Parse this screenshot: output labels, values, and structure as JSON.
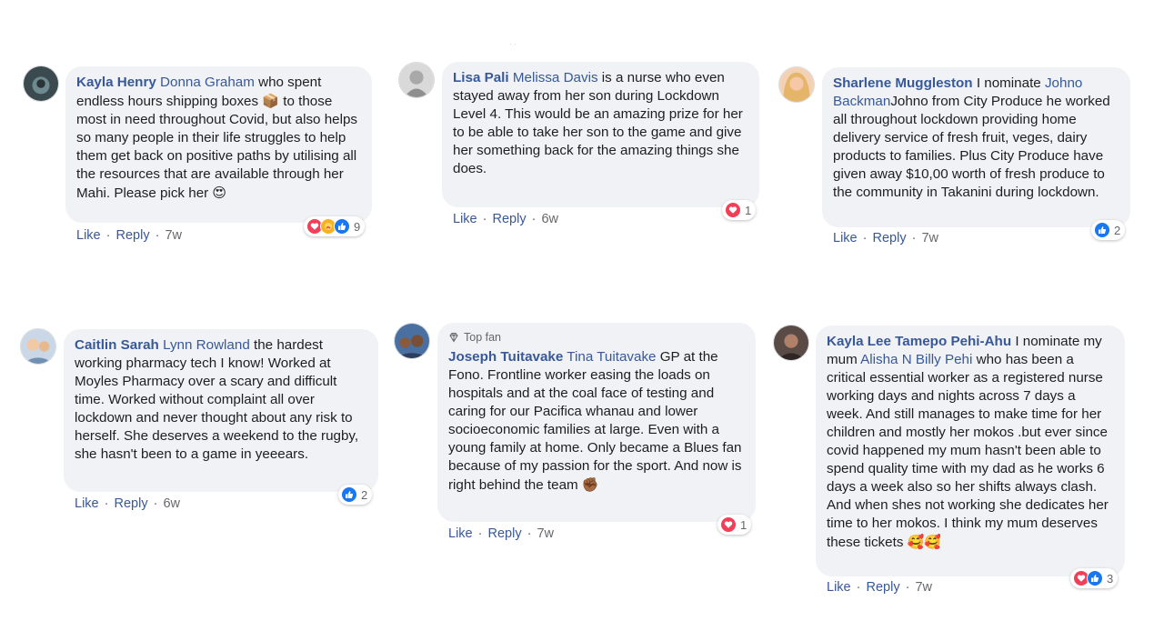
{
  "comments": [
    {
      "author": "Kayla Henry",
      "mention": "Donna Graham",
      "text_before": " who spent endless hours shipping boxes ",
      "emoji1": "📦",
      "text_after": " to those most in need throughout Covid, but also helps so many people in their life struggles to help them get back on positive paths by utilising all the resources that are available through her Mahi. Please pick her ",
      "emoji2": "😍",
      "actions": {
        "like": "Like",
        "reply": "Reply",
        "time": "7w"
      },
      "reaction_count": "9",
      "reaction_icons": [
        "love-icon",
        "care-icon",
        "like-icon"
      ]
    },
    {
      "author": "Lisa Pali",
      "mention": "Melissa Davis",
      "text_after": " is a nurse who even stayed away from her son during Lockdown Level 4. This would be an amazing prize for her to be able to take her son to the game and give her something back for the amazing things she does.",
      "actions": {
        "like": "Like",
        "reply": "Reply",
        "time": "6w"
      },
      "reaction_count": "1",
      "reaction_icons": [
        "love-icon"
      ]
    },
    {
      "author": "Sharlene Muggleston",
      "text_before": " I nominate ",
      "mention": "Johno Backman",
      "text_after": "Johno from City Produce he worked all throughout lockdown providing home delivery service of fresh fruit, veges, dairy products to families. Plus City Produce have given away $10,00 worth of fresh produce to the community in Takanini during lockdown.",
      "actions": {
        "like": "Like",
        "reply": "Reply",
        "time": "7w"
      },
      "reaction_count": "2",
      "reaction_icons": [
        "like-icon"
      ]
    },
    {
      "author": "Caitlin Sarah",
      "mention": "Lynn Rowland",
      "text_after": " the hardest working pharmacy tech I know! Worked at Moyles Pharmacy over a scary and difficult time. Worked without complaint all over lockdown and never thought about any risk to herself. She deserves a weekend to the rugby, she hasn't been to a game in yeeears.",
      "actions": {
        "like": "Like",
        "reply": "Reply",
        "time": "6w"
      },
      "reaction_count": "2",
      "reaction_icons": [
        "like-icon"
      ]
    },
    {
      "badge": "Top fan",
      "author": "Joseph Tuitavake",
      "mention": "Tina Tuitavake",
      "text_after": " GP at the Fono. Frontline worker easing the loads on hospitals and at the coal face of testing and caring for our Pacifica whanau and lower socioeconomic families at large. Even with a young family at home. Only became a Blues fan because of my passion for the sport. And now is right behind the team ",
      "emoji2": "✊🏾",
      "actions": {
        "like": "Like",
        "reply": "Reply",
        "time": "7w"
      },
      "reaction_count": "1",
      "reaction_icons": [
        "love-icon"
      ]
    },
    {
      "author": "Kayla Lee Tamepo Pehi-Ahu",
      "text_before": " I nominate my mum ",
      "mention": "Alisha N Billy Pehi",
      "text_after": " who has been a critical essential worker as a registered nurse working days and nights across 7 days a week. And still manages to make time for her children and mostly her mokos .but ever since covid happened my mum hasn't been able to spend quality time with my dad as he works 6 days a week also so her shifts always clash. And when shes not working she dedicates her time to her mokos. I think my mum deserves these tickets ",
      "emoji2": "🥰🥰",
      "actions": {
        "like": "Like",
        "reply": "Reply",
        "time": "7w"
      },
      "reaction_count": "3",
      "reaction_icons": [
        "love-icon",
        "like-icon"
      ]
    }
  ],
  "colors": {
    "bubble": "#f0f2f5",
    "name": "#385898",
    "meta": "#65676b",
    "love": "#f33e58",
    "like": "#1877f2",
    "care": "#f7b125"
  }
}
